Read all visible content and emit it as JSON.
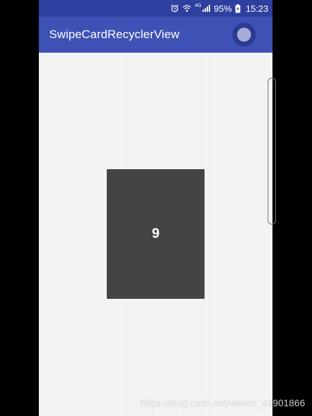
{
  "status_bar": {
    "battery_level": "95%",
    "time": "15:23",
    "network": "4G",
    "icons": [
      "alarm-icon",
      "wifi-icon",
      "signal-icon",
      "battery-charging-icon"
    ]
  },
  "app_bar": {
    "title": "SwipeCardRecyclerView",
    "action_icon": "toggle-circle-icon"
  },
  "card_stack": {
    "top_card_label": "9"
  },
  "watermark": {
    "text": "https://blog.csdn.net/weixin_43901866"
  },
  "colors": {
    "primary": "#3f51b5",
    "primary_dark": "#2f3f9f",
    "card": "#444444",
    "background": "#f4f4f4"
  }
}
